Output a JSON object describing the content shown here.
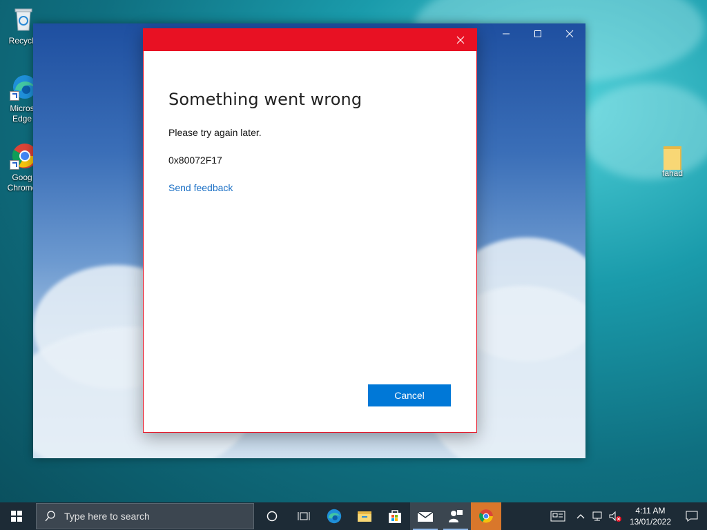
{
  "desktop": {
    "icons": [
      {
        "label": "Recycle",
        "icon": "recycle-bin-icon"
      },
      {
        "label": "Micros Edge",
        "icon": "edge-icon"
      },
      {
        "label": "Goog Chrome",
        "icon": "chrome-icon"
      },
      {
        "label": "fahad",
        "icon": "folder-icon"
      }
    ]
  },
  "dialog": {
    "title": "Something went wrong",
    "message": "Please try again later.",
    "error_code": "0x80072F17",
    "link": "Send feedback",
    "cancel_label": "Cancel",
    "accent": "#e81123",
    "button_color": "#0078d7"
  },
  "taskbar": {
    "search_placeholder": "Type here to search",
    "apps": [
      "cortana-icon",
      "task-view-icon",
      "edge-icon",
      "file-explorer-icon",
      "store-icon",
      "mail-icon",
      "people-icon",
      "chrome-icon"
    ],
    "clock": {
      "time": "4:11 AM",
      "date": "13/01/2022"
    }
  }
}
